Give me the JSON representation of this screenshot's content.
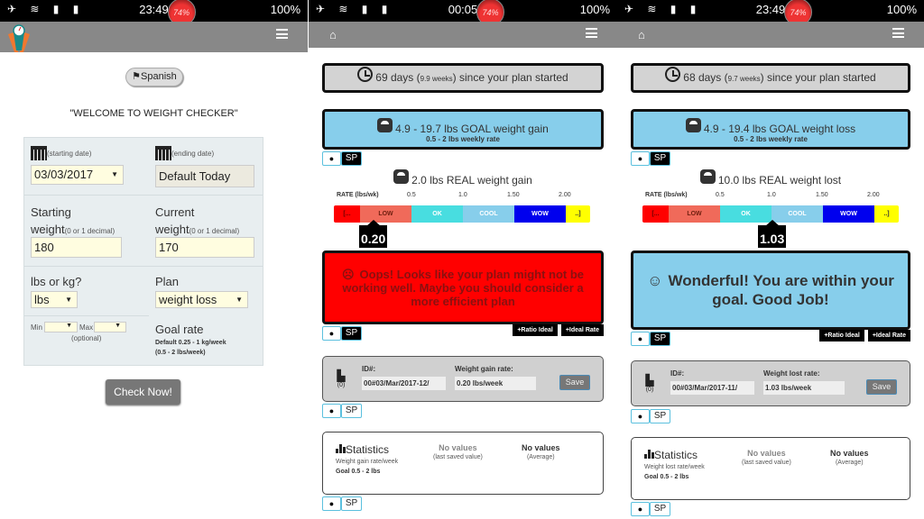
{
  "screens": [
    {
      "status": {
        "time": "23:49",
        "battery": "100%",
        "badge": "74%"
      },
      "spanish_label": "Spanish",
      "welcome": "\"WELCOME TO WEIGHT CHECKER\"",
      "form": {
        "start_date_label": "(starting date)",
        "start_date_value": "03/03/2017",
        "end_date_label": "(ending date)",
        "end_date_value": "Default Today",
        "start_weight_label": "Starting",
        "start_weight_label2": "weight",
        "weight_hint": "(0 or 1 decimal)",
        "start_weight_value": "180",
        "current_weight_label": "Current",
        "current_weight_label2": "weight",
        "current_weight_value": "170",
        "units_label": "lbs or kg?",
        "units_value": "lbs",
        "plan_label": "Plan",
        "plan_value": "weight loss",
        "min_label": "Min",
        "max_label": "Max",
        "optional": "(optional)",
        "goal_rate_label": "Goal rate",
        "goal_rate_line1": "Default 0.25 - 1 kg/week",
        "goal_rate_line2": "(0.5 - 2 lbs/week)"
      },
      "check_label": "Check Now!"
    },
    {
      "status": {
        "time": "00:05",
        "battery": "100%",
        "badge": "74%"
      },
      "days": "69 days (",
      "weeks": "9.9 weeks",
      "days_tail": ") since your plan started",
      "goal_title": "4.9 - 19.7 lbs GOAL weight gain",
      "goal_sub": "0.5 - 2 lbs weekly rate",
      "info": "i",
      "sp": "SP",
      "real": "2.0 lbs REAL weight gain",
      "rate_label": "RATE (lbs/wk)",
      "rate_ticks": [
        "0.5",
        "1.0",
        "1.50",
        "2.00"
      ],
      "segments": [
        "[...",
        "LOW",
        "OK",
        "COOL",
        "WOW",
        "..]"
      ],
      "marker_value": "0.20",
      "message_emoji": "☹",
      "message": "Oops! Looks like your plan might not be working well. Maybe you should consider a more efficient plan",
      "tag_ratio": "+Ratio Ideal",
      "tag_rate": "+Ideal Rate",
      "save": {
        "count": "(0)",
        "id_label": "ID#:",
        "id_value": "00#03/Mar/2017-12/",
        "rate_label": "Weight gain rate:",
        "rate_value": "0.20 lbs/week",
        "button": "Save"
      },
      "stats": {
        "title": "Statistics",
        "sub1": "Weight gain rate/week",
        "sub2": "Goal 0.5 - 2 lbs",
        "last_value": "No values",
        "last_caption": "(last saved value)",
        "avg_value": "No values",
        "avg_caption": "(Average)"
      }
    },
    {
      "status": {
        "time": "23:49",
        "battery": "100%",
        "badge": "74%"
      },
      "days": "68 days (",
      "weeks": "9.7 weeks",
      "days_tail": ") since your plan started",
      "goal_title": "4.9 - 19.4 lbs GOAL weight loss",
      "goal_sub": "0.5 - 2 lbs weekly rate",
      "info": "i",
      "sp": "SP",
      "real": "10.0 lbs REAL weight lost",
      "rate_label": "RATE (lbs/wk)",
      "rate_ticks": [
        "0.5",
        "1.0",
        "1.50",
        "2.00"
      ],
      "segments": [
        "[...",
        "LOW",
        "OK",
        "COOL",
        "WOW",
        "..]"
      ],
      "marker_value": "1.03",
      "message_emoji": "☺",
      "message": "Wonderful! You are within your goal. Good Job!",
      "tag_ratio": "+Ratio Ideal",
      "tag_rate": "+Ideal Rate",
      "save": {
        "count": "(0)",
        "id_label": "ID#:",
        "id_value": "00#03/Mar/2017-11/",
        "rate_label": "Weight lost rate:",
        "rate_value": "1.03 lbs/week",
        "button": "Save"
      },
      "stats": {
        "title": "Statistics",
        "sub1": "Weight lost rate/week",
        "sub2": "Goal 0.5 - 2 lbs",
        "last_value": "No values",
        "last_caption": "(last saved value)",
        "avg_value": "No values",
        "avg_caption": "(Average)"
      }
    }
  ],
  "colors": {
    "segment_colors": [
      "#ff0000",
      "#f06a5a",
      "#48dde0",
      "#87ceeb",
      "#0000ee",
      "#ffff00"
    ],
    "oops_bg": "#ff0000",
    "good_bg": "#87ceeb",
    "appbar": "#888888"
  }
}
